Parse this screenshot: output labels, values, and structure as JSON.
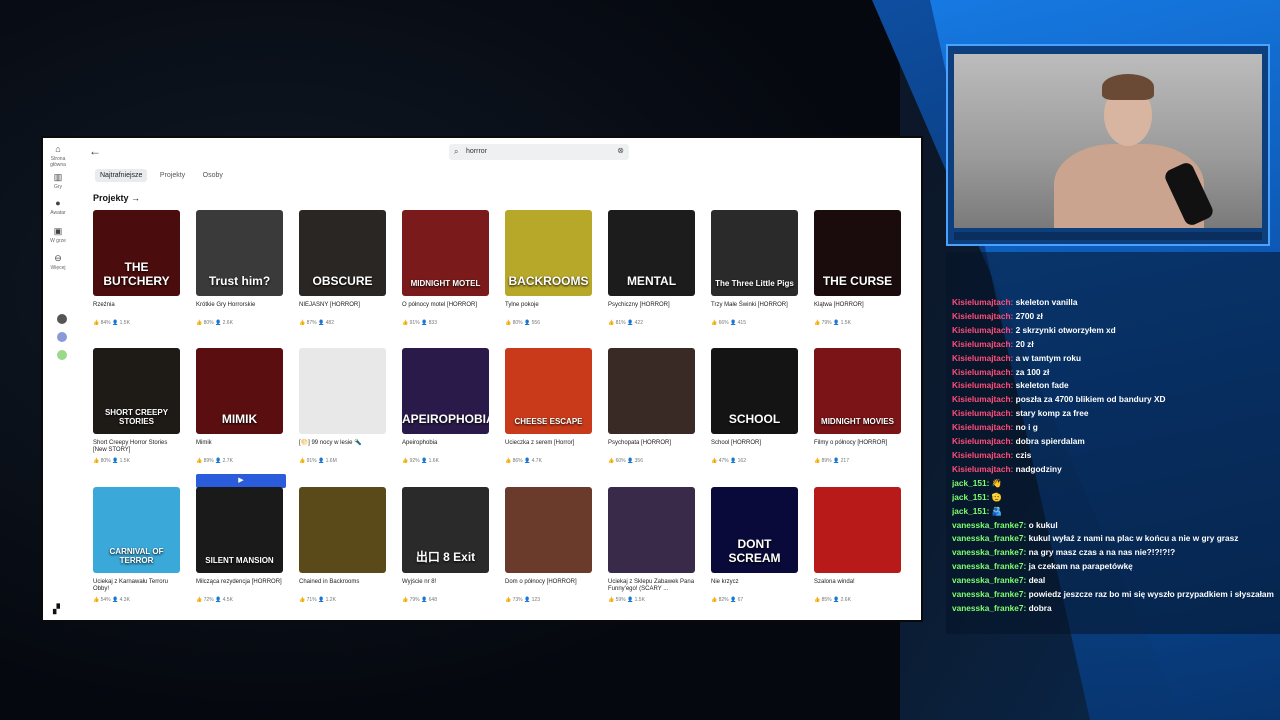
{
  "search": {
    "query": "horrror"
  },
  "tabs": [
    {
      "label": "Najtrafniejsze"
    },
    {
      "label": "Projekty"
    },
    {
      "label": "Osoby"
    }
  ],
  "section_title": "Projekty →",
  "sidebar": {
    "items": [
      {
        "icon": "home-icon",
        "label": "Strona główna"
      },
      {
        "icon": "marketplace-icon",
        "label": "Gry"
      },
      {
        "icon": "avatar-icon",
        "label": "Awatar"
      },
      {
        "icon": "inventory-icon",
        "label": "W grze"
      },
      {
        "icon": "more-icon",
        "label": "Więcej"
      }
    ]
  },
  "play_label": "▶",
  "games": [
    {
      "title": "Rzeźnia",
      "rating": "84%",
      "players": "1.5K",
      "thumb_text": "THE BUTCHERY",
      "thumb_color": "#4a0c0c"
    },
    {
      "title": "Krótkie Gry Horrorskie",
      "rating": "80%",
      "players": "2.6K",
      "thumb_text": "Trust him?",
      "thumb_color": "#3a3a3a"
    },
    {
      "title": "NIEJASNY [HORROR]",
      "rating": "87%",
      "players": "482",
      "thumb_text": "OBSCURE",
      "thumb_color": "#2a2624"
    },
    {
      "title": "O północy motel [HORROR]",
      "rating": "91%",
      "players": "833",
      "thumb_text": "MIDNIGHT MOTEL",
      "thumb_color": "#7a1a1a"
    },
    {
      "title": "Tylne pokoje",
      "rating": "80%",
      "players": "556",
      "thumb_text": "BACKROOMS",
      "thumb_color": "#b8a82a"
    },
    {
      "title": "Psychiczny [HORROR]",
      "rating": "81%",
      "players": "422",
      "thumb_text": "MENTAL",
      "thumb_color": "#1c1c1c"
    },
    {
      "title": "Trzy Małe Świnki [HORROR]",
      "rating": "66%",
      "players": "415",
      "thumb_text": "The Three Little Pigs",
      "thumb_color": "#2a2a2a"
    },
    {
      "title": "Klątwa [HORROR]",
      "rating": "79%",
      "players": "1.5K",
      "thumb_text": "THE CURSE",
      "thumb_color": "#1a0c0c"
    },
    {
      "title": "Short Creepy Horror Stories [New STORY]",
      "rating": "80%",
      "players": "1.5K",
      "thumb_text": "SHORT CREEPY STORIES",
      "thumb_color": "#1e1a16"
    },
    {
      "title": "Mimik",
      "rating": "89%",
      "players": "2.7K",
      "thumb_text": "MIMIK",
      "thumb_color": "#5a0e10"
    },
    {
      "title": "[🌕] 99 nocy w lesie 🔦",
      "rating": "91%",
      "players": "1.6M",
      "thumb_text": "",
      "thumb_color": "#e8e8e8"
    },
    {
      "title": "Apeirophobia",
      "rating": "92%",
      "players": "1.6K",
      "thumb_text": "APEIROPHOBIA",
      "thumb_color": "#2a1a4a"
    },
    {
      "title": "Ucieczka z serem [Horror]",
      "rating": "86%",
      "players": "4.7K",
      "thumb_text": "CHEESE ESCAPE",
      "thumb_color": "#c83a1a"
    },
    {
      "title": "Psychopata [HORROR]",
      "rating": "60%",
      "players": "356",
      "thumb_text": "",
      "thumb_color": "#3a2a26"
    },
    {
      "title": "School [HORROR]",
      "rating": "47%",
      "players": "162",
      "thumb_text": "SCHOOL",
      "thumb_color": "#141414"
    },
    {
      "title": "Filmy o północy [HORROR]",
      "rating": "89%",
      "players": "217",
      "thumb_text": "MIDNIGHT MOVIES",
      "thumb_color": "#7a1416"
    },
    {
      "title": "Uciekaj z Karnawału Terroru Obby!",
      "rating": "54%",
      "players": "4.3K",
      "thumb_text": "CARNIVAL OF TERROR",
      "thumb_color": "#3aa8d8"
    },
    {
      "title": "Milcząca rezydencja [HORROR]",
      "rating": "72%",
      "players": "4.5K",
      "thumb_text": "SILENT MANSION",
      "thumb_color": "#1a1a1a"
    },
    {
      "title": "Chained in Backrooms",
      "rating": "71%",
      "players": "1.2K",
      "thumb_text": "",
      "thumb_color": "#5a4a1a"
    },
    {
      "title": "Wyjście nr 8!",
      "rating": "79%",
      "players": "648",
      "thumb_text": "出口 8 Exit",
      "thumb_color": "#2a2a2a"
    },
    {
      "title": "Dom o północy [HORROR]",
      "rating": "73%",
      "players": "123",
      "thumb_text": "",
      "thumb_color": "#6a3a2a"
    },
    {
      "title": "Uciekaj z Sklepu Zabawek Pana Funny'ego! (SCARY ...",
      "rating": "59%",
      "players": "1.5K",
      "thumb_text": "",
      "thumb_color": "#3a2a4a"
    },
    {
      "title": "Nie krzycz",
      "rating": "82%",
      "players": "67",
      "thumb_text": "DONT SCREAM",
      "thumb_color": "#0a0a3a"
    },
    {
      "title": "Szalona winda!",
      "rating": "85%",
      "players": "2.6K",
      "thumb_text": "",
      "thumb_color": "#b81a1a"
    }
  ],
  "chat": [
    {
      "user": "Kisielumajtach:",
      "msg": "skeleton vanilla"
    },
    {
      "user": "Kisielumajtach:",
      "msg": "2700 zł"
    },
    {
      "user": "Kisielumajtach:",
      "msg": "2 skrzynki otworzyłem xd"
    },
    {
      "user": "Kisielumajtach:",
      "msg": "20 zł"
    },
    {
      "user": "Kisielumajtach:",
      "msg": "a w tamtym roku"
    },
    {
      "user": "Kisielumajtach:",
      "msg": "za 100 zł"
    },
    {
      "user": "Kisielumajtach:",
      "msg": "skeleton fade"
    },
    {
      "user": "Kisielumajtach:",
      "msg": "poszła za 4700 blikiem od bandury XD"
    },
    {
      "user": "Kisielumajtach:",
      "msg": "stary komp za free"
    },
    {
      "user": "Kisielumajtach:",
      "msg": "no i g"
    },
    {
      "user": "Kisielumajtach:",
      "msg": "dobra spierdalam"
    },
    {
      "user": "Kisielumajtach:",
      "msg": "czis"
    },
    {
      "user": "Kisielumajtach:",
      "msg": "nadgodziny"
    },
    {
      "user": "jack_151:",
      "msg": "👋"
    },
    {
      "user": "jack_151:",
      "msg": "🫡"
    },
    {
      "user": "jack_151:",
      "msg": "🫂"
    },
    {
      "user": "vanesska_franke7:",
      "msg": "o kukul"
    },
    {
      "user": "vanesska_franke7:",
      "msg": "kukul wyłaź z nami na plac w końcu a nie w gry grasz"
    },
    {
      "user": "vanesska_franke7:",
      "msg": "na gry masz czas a na nas nie?!?!?!?"
    },
    {
      "user": "vanesska_franke7:",
      "msg": "ja czekam na parapetówkę"
    },
    {
      "user": "vanesska_franke7:",
      "msg": "deal"
    },
    {
      "user": "vanesska_franke7:",
      "msg": "powiedz jeszcze raz bo mi się wyszło przypadkiem i słyszałam"
    },
    {
      "user": "vanesska_franke7:",
      "msg": "dobra"
    }
  ]
}
